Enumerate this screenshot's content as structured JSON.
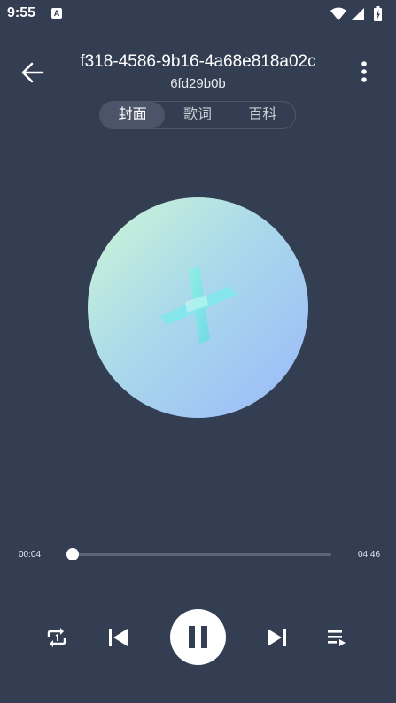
{
  "status": {
    "time": "9:55",
    "notification_icon": "accessibility-a-icon",
    "icons": [
      "wifi-icon",
      "cellular-signal-icon",
      "battery-charging-icon"
    ]
  },
  "header": {
    "title": "f318-4586-9b16-4a68e818a02c",
    "subtitle": "6fd29b0b",
    "back_icon": "arrow-back-icon",
    "menu_icon": "more-vert-icon"
  },
  "tabs": [
    {
      "label": "封面",
      "active": true
    },
    {
      "label": "歌词",
      "active": false
    },
    {
      "label": "百科",
      "active": false
    }
  ],
  "cover": {
    "logo_icon": "x-logo-icon"
  },
  "player": {
    "current_time": "00:04",
    "total_time": "04:46",
    "progress_fraction": 0.014
  },
  "controls": [
    "repeat-one-icon",
    "skip-previous-icon",
    "pause-icon",
    "skip-next-icon",
    "playlist-icon"
  ],
  "colors": {
    "background": "#343e52",
    "accent": "#ffffff"
  }
}
